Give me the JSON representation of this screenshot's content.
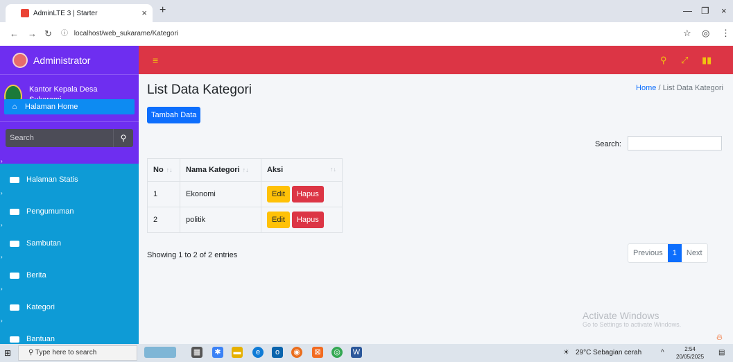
{
  "browser": {
    "tab_title": "AdminLTE 3 | Starter",
    "url": "localhost/web_sukarame/Kategori"
  },
  "sidebar": {
    "brand": "Administrator",
    "user_line1": "Kantor Kepala Desa",
    "user_line2": "Sukarami",
    "search_placeholder": "Search",
    "active_item": "Halaman Home",
    "items": [
      {
        "label": "Halaman Statis"
      },
      {
        "label": "Pengumuman"
      },
      {
        "label": "Sambutan"
      },
      {
        "label": "Berita"
      },
      {
        "label": "Kategori"
      },
      {
        "label": "Bantuan"
      }
    ]
  },
  "content": {
    "title": "List Data Kategori",
    "breadcrumb_home": "Home",
    "breadcrumb_sep": "/",
    "breadcrumb_current": "List Data Kategori",
    "add_button": "Tambah Data",
    "search_label": "Search:",
    "columns": [
      "No",
      "Nama Kategori",
      "Aksi"
    ],
    "rows": [
      {
        "no": "1",
        "nama": "Ekonomi"
      },
      {
        "no": "2",
        "nama": "politik"
      }
    ],
    "edit_label": "Edit",
    "delete_label": "Hapus",
    "info": "Showing 1 to 2 of 2 entries",
    "pager_prev": "Previous",
    "pager_current": "1",
    "pager_next": "Next"
  },
  "watermark": {
    "line1": "Activate Windows",
    "line2": "Go to Settings to activate Windows."
  },
  "taskbar": {
    "search_placeholder": "Type here to search",
    "weather": "29°C  Sebagian cerah",
    "time": "2:54",
    "date": "20/05/2025"
  },
  "colors": {
    "sidebar": "#6e2ef0",
    "menu": "#0e9bd6",
    "navbar": "#dc3545",
    "primary": "#0d6efd",
    "warning": "#ffc107",
    "danger": "#dc3545"
  }
}
